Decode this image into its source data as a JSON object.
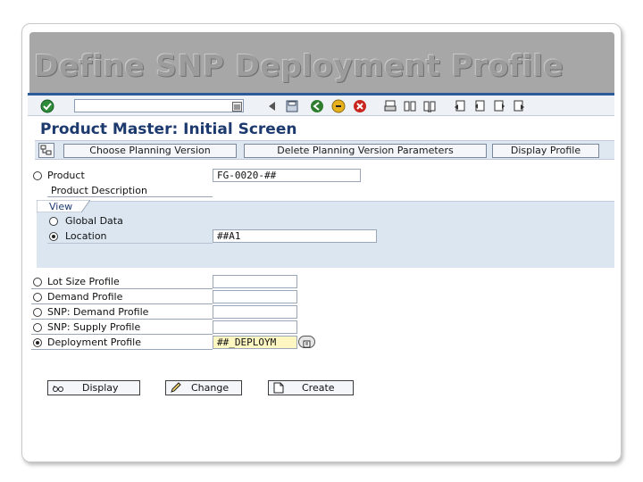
{
  "slide": {
    "title": "Define SNP Deployment Profile"
  },
  "screen": {
    "title": "Product Master: Initial Screen",
    "command_field_value": ""
  },
  "toolbar": {
    "icons": [
      "enter-icon",
      "command-dropdown-icon",
      "back-icon",
      "save-icon",
      "green-back-icon",
      "exit-icon",
      "cancel-icon",
      "print-icon",
      "find-icon",
      "find-next-icon",
      "first-page-icon",
      "prev-page-icon",
      "next-page-icon",
      "last-page-icon"
    ]
  },
  "app_toolbar": {
    "choose_planning_version": "Choose Planning Version",
    "delete_planning_version_parameters": "Delete Planning Version Parameters",
    "display_profile": "Display Profile"
  },
  "form": {
    "product": {
      "label": "Product",
      "value": "FG-0020-##"
    },
    "product_description": {
      "label": "Product Description"
    },
    "view": {
      "label": "View",
      "global_data": {
        "label": "Global Data"
      },
      "location": {
        "label": "Location",
        "value": "##A1"
      }
    },
    "lot_size_profile": {
      "label": "Lot Size Profile",
      "value": ""
    },
    "demand_profile": {
      "label": "Demand Profile",
      "value": ""
    },
    "snp_demand_profile": {
      "label": "SNP: Demand Profile",
      "value": ""
    },
    "snp_supply_profile": {
      "label": "SNP: Supply Profile",
      "value": ""
    },
    "deployment_profile": {
      "label": "Deployment Profile",
      "value": "##_DEPLOYM"
    }
  },
  "actions": {
    "display": "Display",
    "change": "Change",
    "create": "Create"
  },
  "colors": {
    "title_band": "#a7a7a7",
    "title_text": "#9c9c9c",
    "sap_blue": "#2d5b9a",
    "group_bg": "#dce6f0",
    "field_yellow": "#fff7c2"
  }
}
